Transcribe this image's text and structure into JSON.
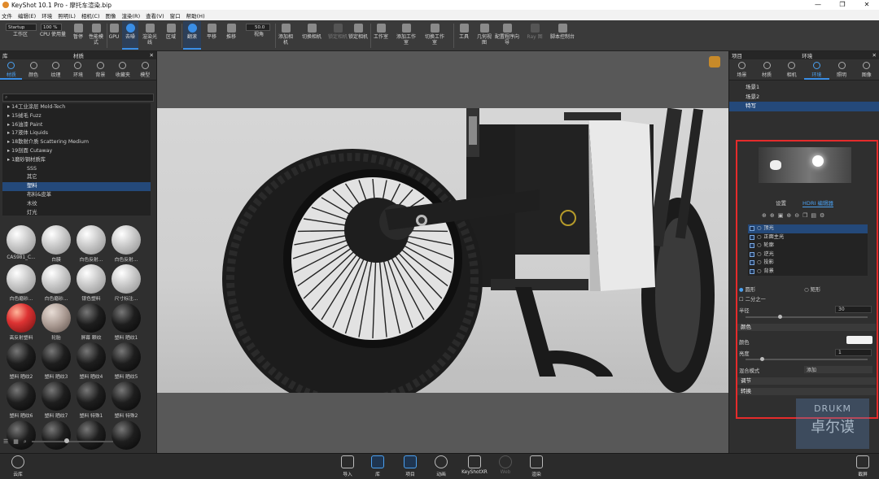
{
  "window": {
    "title": "KeyShot 10.1 Pro - 摩托车渲染.bip",
    "controls": [
      "—",
      "❐",
      "✕"
    ]
  },
  "menu": [
    "文件",
    "编辑(E)",
    "环境",
    "照明(L)",
    "相机(C)",
    "图像",
    "渲染(R)",
    "查看(V)",
    "窗口",
    "帮助(H)"
  ],
  "toolbar": {
    "preset_value": "Startup",
    "zoom_value": "100 %",
    "fov_value": "50.0",
    "buttons": [
      "工作区",
      "CPU 使用量",
      "暂停",
      "性能模式",
      "GPU",
      "去噪",
      "渲染光线",
      "区域",
      "翻滚",
      "平移",
      "推移",
      "视角",
      "添加相机",
      "切换相机",
      "锁定相机",
      "锁定相机",
      "工作室",
      "添加工作室",
      "切换工作室",
      "工具",
      "几何视图",
      "配置程序向导",
      "Ray 图",
      "脚本控制台"
    ]
  },
  "left_panel": {
    "header_left": "库",
    "header_center": "材质",
    "tabs": [
      "材质",
      "颜色",
      "纹理",
      "环境",
      "背景",
      "收藏夹",
      "模型"
    ],
    "search_placeholder": "",
    "tree": [
      {
        "label": "14工业涂层 Mold-Tech",
        "sub": false
      },
      {
        "label": "15绒毛 Fuzz",
        "sub": false
      },
      {
        "label": "16油漆 Paint",
        "sub": false
      },
      {
        "label": "17液体 Liquids",
        "sub": false
      },
      {
        "label": "18散射介质 Scattering Medium",
        "sub": false
      },
      {
        "label": "19剖面 Cutaway",
        "sub": false
      },
      {
        "label": "1磨砂钢材质库",
        "sub": false
      },
      {
        "label": "SSS",
        "sub": true
      },
      {
        "label": "其它",
        "sub": true
      },
      {
        "label": "塑料",
        "sub": true,
        "selected": true
      },
      {
        "label": "布料&皮革",
        "sub": true
      },
      {
        "label": "木纹",
        "sub": true
      },
      {
        "label": "灯光",
        "sub": true
      }
    ],
    "materials": [
      {
        "label": "CAS981_C...",
        "kind": "white"
      },
      {
        "label": "白膜",
        "kind": "white"
      },
      {
        "label": "白色反射...",
        "kind": "white"
      },
      {
        "label": "白色反射...",
        "kind": "white"
      },
      {
        "label": "白色磨砂...",
        "kind": "white"
      },
      {
        "label": "白色磨砂...",
        "kind": "white"
      },
      {
        "label": "银色塑料",
        "kind": "white"
      },
      {
        "label": "尺寸标注...",
        "kind": "white"
      },
      {
        "label": "高反射塑料",
        "kind": "red"
      },
      {
        "label": "轮胎",
        "kind": "stone"
      },
      {
        "label": "屏幕 颗纹",
        "kind": "black"
      },
      {
        "label": "塑料 晒纹1",
        "kind": "black"
      },
      {
        "label": "塑料 晒纹2",
        "kind": "black"
      },
      {
        "label": "塑料 晒纹3",
        "kind": "black"
      },
      {
        "label": "塑料 晒纹4",
        "kind": "black"
      },
      {
        "label": "塑料 晒纹5",
        "kind": "black"
      },
      {
        "label": "塑料 晒纹6",
        "kind": "black"
      },
      {
        "label": "塑料 晒纹7",
        "kind": "black"
      },
      {
        "label": "塑料 特殊1",
        "kind": "black"
      },
      {
        "label": "塑料 特殊2",
        "kind": "black"
      },
      {
        "label": "",
        "kind": "black"
      },
      {
        "label": "",
        "kind": "black"
      },
      {
        "label": "",
        "kind": "black"
      },
      {
        "label": "",
        "kind": "black"
      }
    ]
  },
  "right_panel": {
    "header_left": "项目",
    "header_center": "环境",
    "tabs": [
      "场景",
      "材质",
      "相机",
      "环境",
      "照明",
      "图像"
    ],
    "scenes": [
      {
        "label": "场景1"
      },
      {
        "label": "场景2"
      },
      {
        "label": "特写",
        "selected": true
      }
    ],
    "subtabs": [
      "设置",
      "HDRI 编辑器"
    ],
    "layers": [
      {
        "label": "顶光",
        "selected": true
      },
      {
        "label": "正面主光"
      },
      {
        "label": "轮廓"
      },
      {
        "label": "逆光"
      },
      {
        "label": "投影"
      },
      {
        "label": "背景"
      }
    ],
    "shape_options": [
      "圆形",
      "矩形"
    ],
    "half_label": "二分之一",
    "radius_label": "半径",
    "radius_value": "30",
    "color_header": "颜色",
    "color_label": "颜色",
    "brightness_label": "亮度",
    "brightness_value": "1",
    "blend_label": "混合模式",
    "blend_value": "添加",
    "adjust_label": "调节",
    "transform_label": "转换"
  },
  "bottom_bar": {
    "cloud": "云库",
    "buttons": [
      "导入",
      "库",
      "项目",
      "动画",
      "KeyShotXR",
      "Web",
      "渲染"
    ],
    "screenshot": "截屏"
  },
  "watermark": {
    "top": "DRUKM",
    "bottom": "卓尔谟"
  },
  "colors": {
    "accent": "#3a8ee6",
    "selection": "#24497a",
    "highlight_box": "#e52b2b"
  }
}
